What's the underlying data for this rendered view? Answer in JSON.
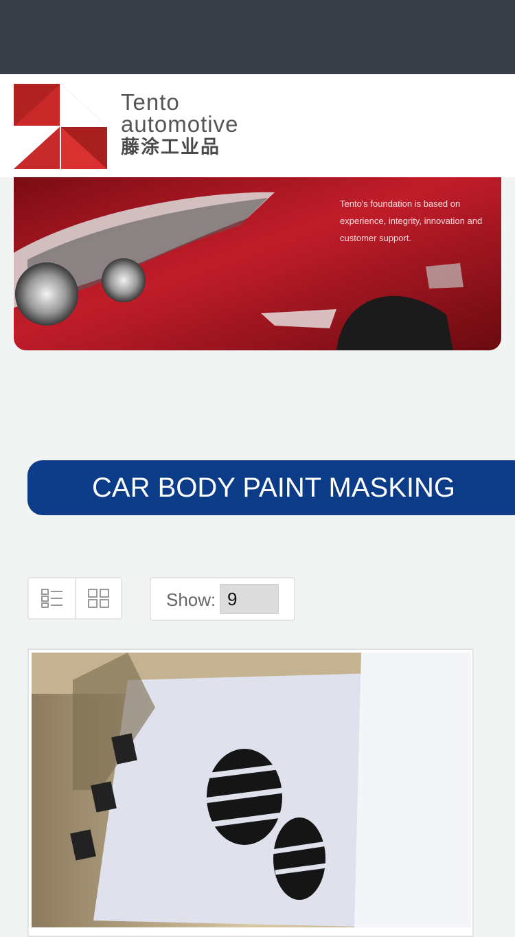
{
  "header": {
    "brand_line1": "Tento",
    "brand_line2": "automotive",
    "brand_line3": "藤涂工业品",
    "logo_colors": {
      "red": "#d42a2a",
      "white": "#ffffff"
    }
  },
  "banner": {
    "caption": "Tento's foundation is based on experience, integrity, innovation and customer support."
  },
  "category": {
    "title": "CAR BODY PAINT MASKING",
    "color": "#0c3c87"
  },
  "toolbar": {
    "list_view_icon": "list-view-icon",
    "grid_view_icon": "grid-view-icon",
    "show_label": "Show:",
    "show_value": "9"
  },
  "products": [
    {
      "image_icon": "car-floor-mat-image"
    }
  ]
}
